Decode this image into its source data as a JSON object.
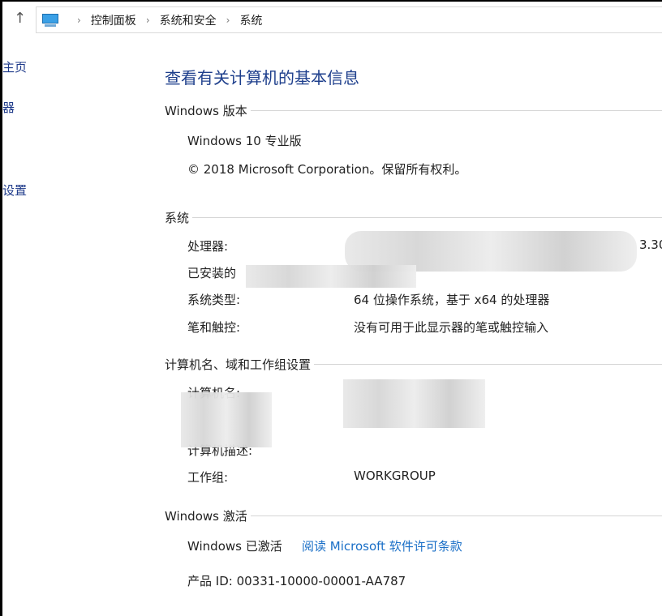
{
  "breadcrumb": {
    "items": [
      "控制面板",
      "系统和安全",
      "系统"
    ]
  },
  "sidebar": {
    "items": [
      "主页",
      "器",
      "设置"
    ]
  },
  "page_title": "查看有关计算机的基本信息",
  "edition": {
    "header": "Windows 版本",
    "name": "Windows 10 专业版",
    "copyright": "© 2018 Microsoft Corporation。保留所有权利。"
  },
  "system": {
    "header": "系统",
    "processor_label": "处理器:",
    "processor_value": "3.30",
    "ram_label": "已安装的",
    "type_label": "系统类型:",
    "type_value": "64 位操作系统，基于 x64 的处理器",
    "pen_label": "笔和触控:",
    "pen_value": "没有可用于此显示器的笔或触控输入"
  },
  "computer": {
    "header": "计算机名、域和工作组设置",
    "name_label": "计算机名:",
    "desc_label": "计算机描述:",
    "workgroup_label": "工作组:",
    "workgroup_value": "WORKGROUP"
  },
  "activation": {
    "header": "Windows 激活",
    "status": "Windows 已激活",
    "license_link": "阅读 Microsoft 软件许可条款",
    "product_id": "产品 ID: 00331-10000-00001-AA787"
  }
}
